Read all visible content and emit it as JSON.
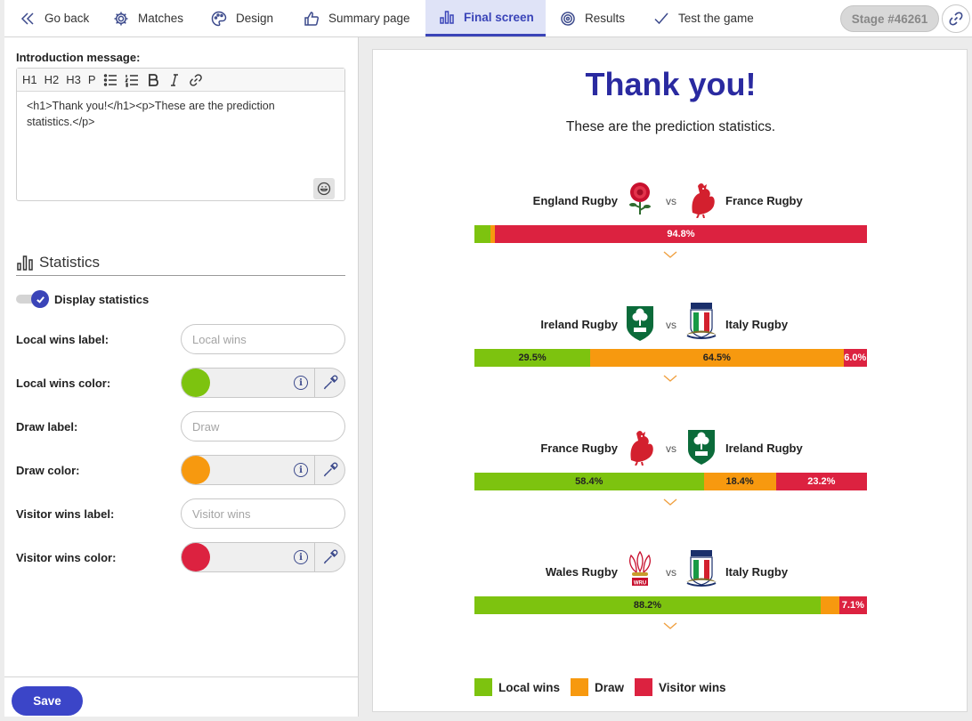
{
  "nav": {
    "tabs": [
      {
        "label": "Go back",
        "icon": "chevron-left-icon"
      },
      {
        "label": "Matches",
        "icon": "gear-icon"
      },
      {
        "label": "Design",
        "icon": "palette-icon"
      },
      {
        "label": "Summary page",
        "icon": "thumbs-up-icon"
      },
      {
        "label": "Final screen",
        "icon": "bar-chart-icon",
        "active": true
      },
      {
        "label": "Results",
        "icon": "target-icon"
      },
      {
        "label": "Test the game",
        "icon": "checkmark-icon"
      }
    ],
    "stage": "Stage #46261"
  },
  "editor": {
    "label": "Introduction message:",
    "toolbar": [
      "H1",
      "H2",
      "H3",
      "P"
    ],
    "content": "<h1>Thank you!</h1><p>These are the prediction statistics.</p>"
  },
  "statistics": {
    "heading": "Statistics",
    "toggle_label": "Display statistics",
    "toggle_on": true,
    "local_label": {
      "label": "Local wins label:",
      "placeholder": "Local wins"
    },
    "local_color": {
      "label": "Local wins color:",
      "color": "#7dc30f"
    },
    "draw_label": {
      "label": "Draw label:",
      "placeholder": "Draw"
    },
    "draw_color": {
      "label": "Draw color:",
      "color": "#f7990f"
    },
    "visitor_label": {
      "label": "Visitor wins label:",
      "placeholder": "Visitor wins"
    },
    "visitor_color": {
      "label": "Visitor wins color:",
      "color": "#dc2240"
    }
  },
  "save_label": "Save",
  "preview": {
    "title": "Thank you!",
    "subtitle": "These are the prediction statistics.",
    "vs": "vs",
    "matches": [
      {
        "local": "England Rugby",
        "visitor": "France Rugby",
        "local_logo": "rose-logo-icon",
        "visitor_logo": "rooster-logo-icon",
        "local_pct": 4.0,
        "draw_pct": 1.2,
        "visitor_pct": 94.8,
        "local_text": "",
        "draw_text": "",
        "visitor_text": "94.8%"
      },
      {
        "local": "Ireland Rugby",
        "visitor": "Italy Rugby",
        "local_logo": "shamrock-logo-icon",
        "visitor_logo": "italy-shield-logo-icon",
        "local_pct": 29.5,
        "draw_pct": 64.5,
        "visitor_pct": 6.0,
        "local_text": "29.5%",
        "draw_text": "64.5%",
        "visitor_text": "6.0%"
      },
      {
        "local": "France Rugby",
        "visitor": "Ireland Rugby",
        "local_logo": "rooster-logo-icon",
        "visitor_logo": "shamrock-logo-icon",
        "local_pct": 58.4,
        "draw_pct": 18.4,
        "visitor_pct": 23.2,
        "local_text": "58.4%",
        "draw_text": "18.4%",
        "visitor_text": "23.2%"
      },
      {
        "local": "Wales Rugby",
        "visitor": "Italy Rugby",
        "local_logo": "feathers-logo-icon",
        "visitor_logo": "italy-shield-logo-icon",
        "local_pct": 88.2,
        "draw_pct": 4.7,
        "visitor_pct": 7.1,
        "local_text": "88.2%",
        "draw_text": "",
        "visitor_text": "7.1%"
      }
    ],
    "legend": [
      {
        "label": "Local wins",
        "color": "#7dc30f"
      },
      {
        "label": "Draw",
        "color": "#f7990f"
      },
      {
        "label": "Visitor wins",
        "color": "#dc2240"
      }
    ]
  }
}
